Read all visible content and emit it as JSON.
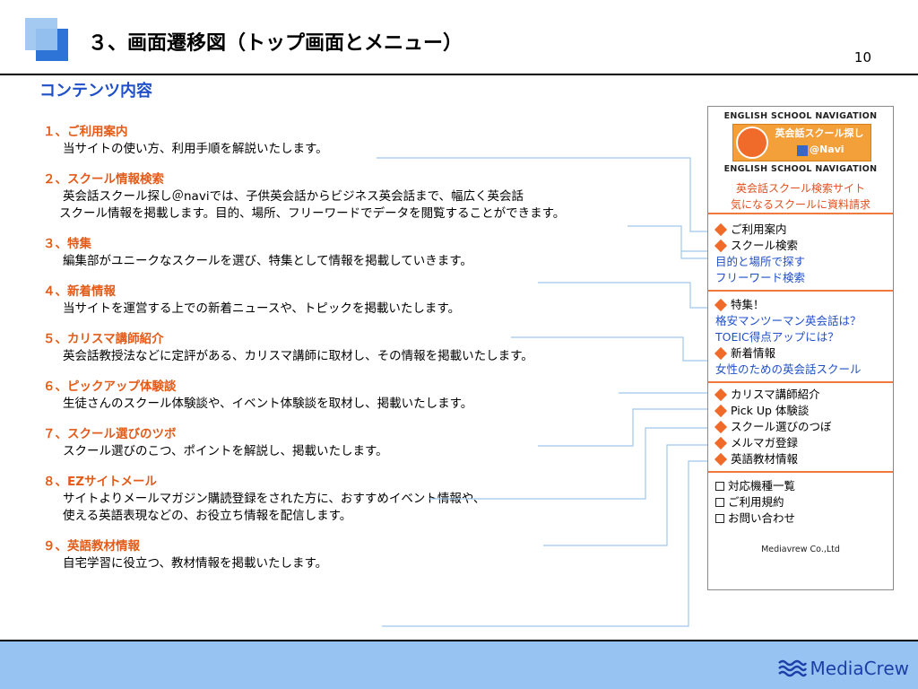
{
  "header": {
    "title": "３、画面遷移図（トップ画面とメニュー）",
    "page_number": "10",
    "content_heading": "コンテンツ内容"
  },
  "sections": [
    {
      "title": "１、ご利用案内",
      "lines": [
        "当サイトの使い方、利用手順を解説いたします。"
      ]
    },
    {
      "title": "２、スクール情報検索",
      "lines": [
        "英会話スクール探し＠naviでは、子供英会話からビジネス英会話まで、幅広く英会話",
        "スクール情報を掲載します。目的、場所、フリーワードでデータを閲覧することができます。"
      ]
    },
    {
      "title": "３、特集",
      "lines": [
        "編集部がユニークなスクールを選び、特集として情報を掲載していきます。"
      ]
    },
    {
      "title": "４、新着情報",
      "lines": [
        "当サイトを運営する上での新着ニュースや、トピックを掲載いたします。"
      ]
    },
    {
      "title": "５、カリスマ講師紹介",
      "lines": [
        "英会話教授法などに定評がある、カリスマ講師に取材し、その情報を掲載いたします。"
      ]
    },
    {
      "title": "６、ピックアップ体験談",
      "lines": [
        "生徒さんのスクール体験談や、イベント体験談を取材し、掲載いたします。"
      ]
    },
    {
      "title": "７、スクール選びのツボ",
      "lines": [
        "スクール選びのこつ、ポイントを解説し、掲載いたします。"
      ]
    },
    {
      "title": "８、EZサイトメール",
      "lines": [
        "サイトよりメールマガジン購読登録をされた方に、おすすめイベント情報や、",
        "使える英語表現などの、お役立ち情報を配信します。"
      ]
    },
    {
      "title": "９、英語教材情報",
      "lines": [
        "自宅学習に役立つ、教材情報を掲載いたします。"
      ]
    }
  ],
  "panel": {
    "banner_top": "ENGLISH SCHOOL NAVIGATION",
    "banner_name": "英会話スクール探し",
    "banner_navi": "@Navi",
    "banner_bottom": "ENGLISH SCHOOL NAVIGATION",
    "tagline1": "英会話スクール検索サイト",
    "tagline2": "気になるスクールに資料請求",
    "menu1": [
      {
        "label": "ご利用案内",
        "style": "diamond"
      },
      {
        "label": "スクール検索",
        "style": "diamond"
      },
      {
        "label": "目的と場所で探す",
        "style": "link"
      },
      {
        "label": "フリーワード検索",
        "style": "link"
      }
    ],
    "menu2": [
      {
        "label": "特集！",
        "style": "diamond"
      },
      {
        "label": "格安マンツーマン英会話は？",
        "style": "link"
      },
      {
        "label": "TOEIC得点アップには？",
        "style": "link"
      },
      {
        "label": "新着情報",
        "style": "diamond"
      },
      {
        "label": "女性のための英会話スクール",
        "style": "link"
      }
    ],
    "menu3": [
      {
        "label": "カリスマ講師紹介",
        "style": "diamond"
      },
      {
        "label": "Pick Up 体験談",
        "style": "diamond"
      },
      {
        "label": "スクール選びのつぼ",
        "style": "diamond"
      },
      {
        "label": "メルマガ登録",
        "style": "diamond"
      },
      {
        "label": "英語教材情報",
        "style": "diamond"
      }
    ],
    "menu4": [
      {
        "label": "対応機種一覧",
        "style": "check"
      },
      {
        "label": "ご利用規約",
        "style": "check"
      },
      {
        "label": "お問い合わせ",
        "style": "check"
      }
    ],
    "company": "Mediavrew Co.,Ltd"
  },
  "footer": {
    "brand": "MediaCrew"
  },
  "colors": {
    "accent_orange": "#e35b18",
    "link_blue": "#1f4fc8",
    "footer_blue": "#97c3f2",
    "connector": "#9fc8ee"
  }
}
